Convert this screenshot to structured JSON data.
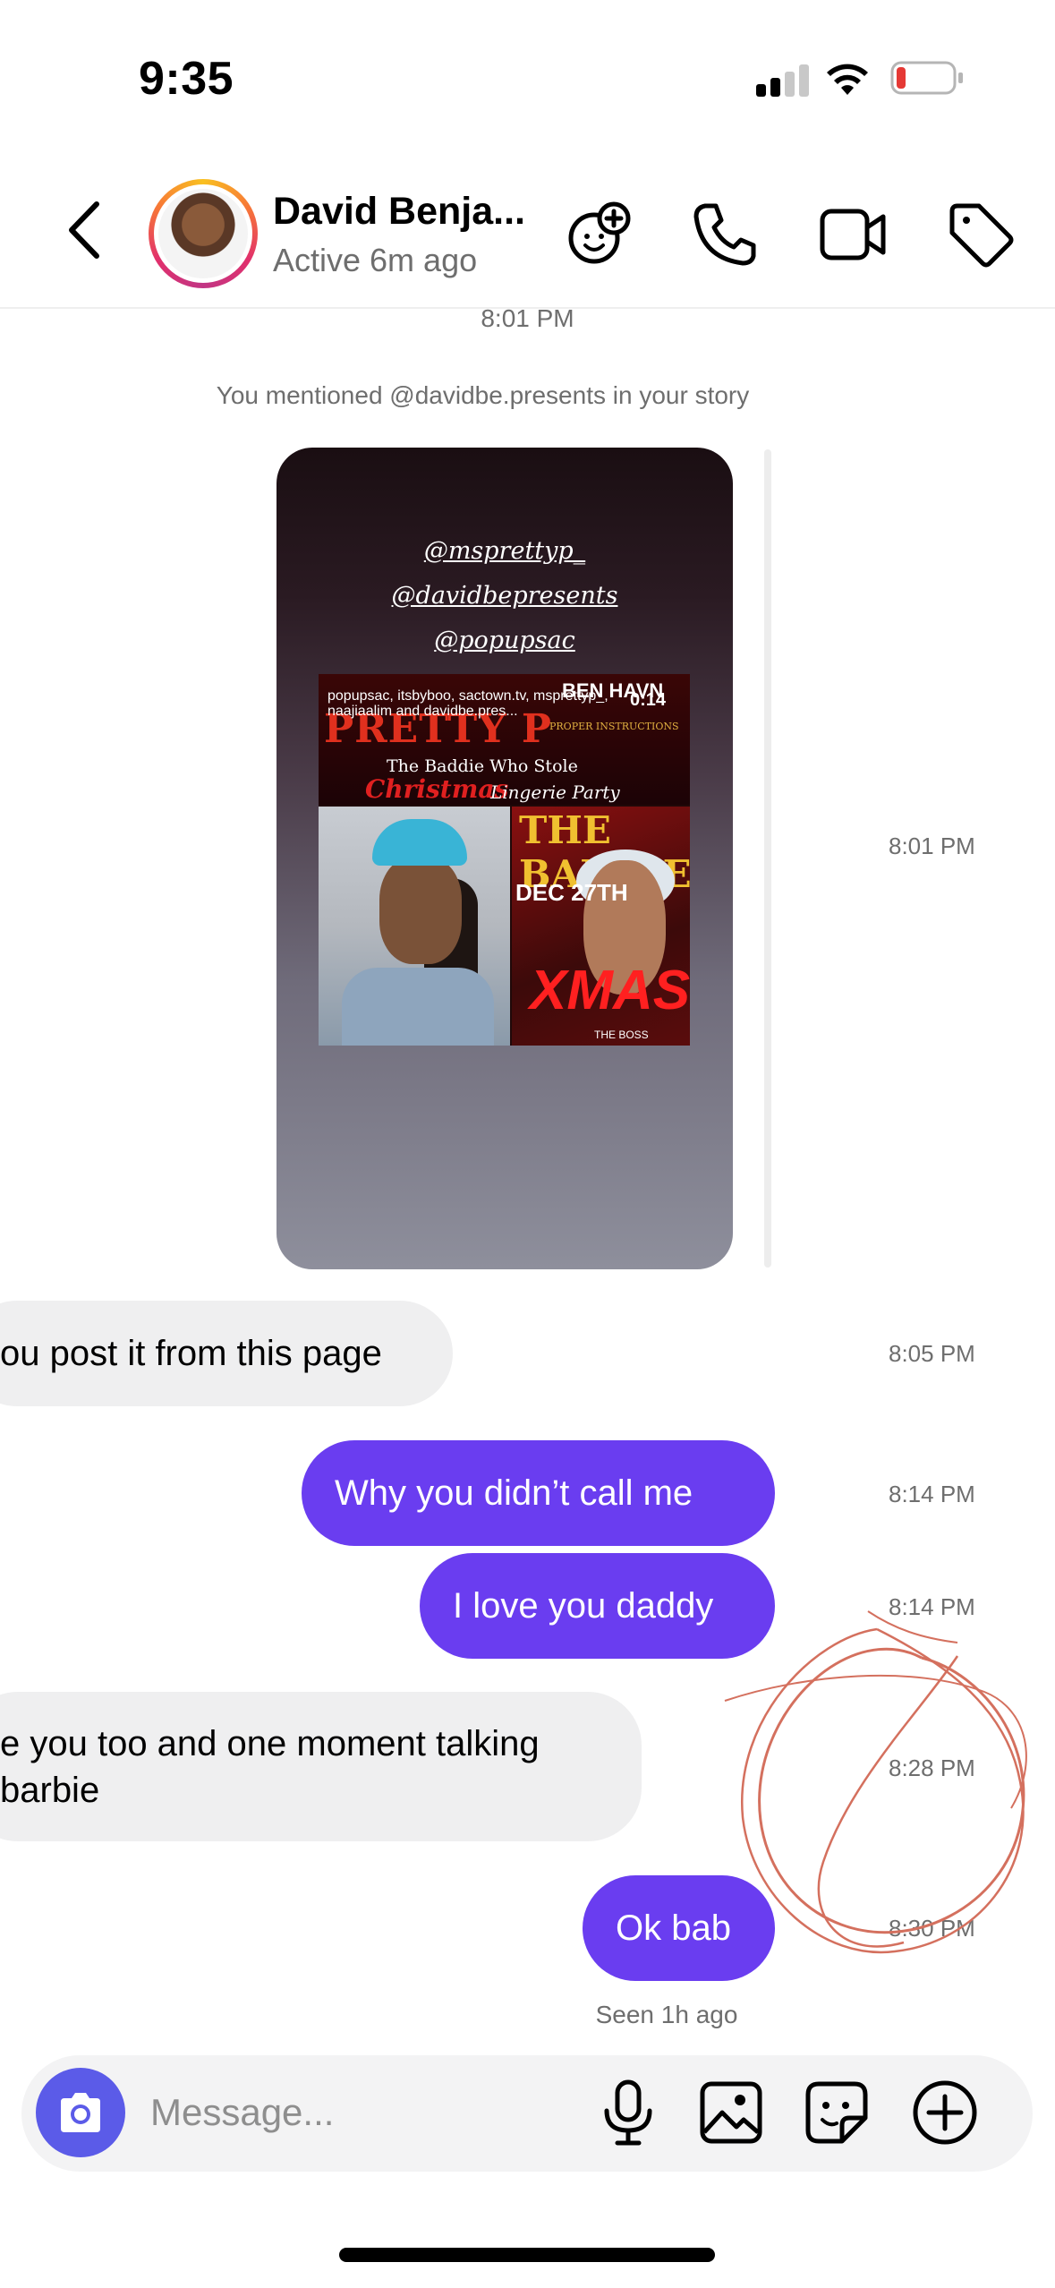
{
  "status_bar": {
    "time": "9:35"
  },
  "header": {
    "contact_name": "David Benja...",
    "contact_status": "Active 6m ago",
    "icons": [
      "back-chevron-icon",
      "effects-icon",
      "phone-icon",
      "video-call-icon",
      "tag-icon"
    ]
  },
  "conversation": {
    "top_timestamp": "8:01 PM",
    "story_notice": "You mentioned @davidbe.presents in your story",
    "story": {
      "mentions": [
        "@msprettyp_",
        "@davidbepresents",
        "@popupsac"
      ],
      "overlay_text": "popupsac, itsbyboo, sactown.tv, msprettyp_, naajiaalim and davidbe.pres...",
      "duration": "0:14",
      "flyer_title": "PRETTY P",
      "flyer_artist": "BEN HAVN",
      "flyer_subtitle": "PROPER INSTRUCTIONS",
      "flyer_tagline": "The Baddie Who Stole",
      "flyer_christmas": "Christmas",
      "flyer_party": "Lingerie Party",
      "flyer_right_title": "THE BADDIES",
      "flyer_right_date": "DEC 27TH",
      "flyer_right_xmas": "XMAS",
      "flyer_right_footer": "THE BOSS",
      "timestamp": "8:01 PM"
    },
    "messages": [
      {
        "direction": "in",
        "text": "ou post it from this page",
        "time": "8:05 PM"
      },
      {
        "direction": "out",
        "text": "Why you didn’t call me",
        "time": "8:14 PM"
      },
      {
        "direction": "out",
        "text": "I love you daddy",
        "time": "8:14 PM"
      },
      {
        "direction": "in",
        "text": "e you too and one moment talking barbie",
        "line1": "e you too and one moment talking",
        "line2": "barbie",
        "time": "8:28 PM"
      },
      {
        "direction": "out",
        "text": "Ok bab",
        "time": "8:30 PM"
      }
    ],
    "seen_status": "Seen 1h ago"
  },
  "composer": {
    "placeholder": "Message...",
    "icons": [
      "camera-icon",
      "microphone-icon",
      "gallery-icon",
      "sticker-icon",
      "add-icon"
    ]
  },
  "colors": {
    "outgoing_bubble": "#6a3df0",
    "incoming_bubble": "#efeff0",
    "camera_button": "#5b5be8",
    "battery_low": "#e53935",
    "scribble": "#d4705e"
  }
}
